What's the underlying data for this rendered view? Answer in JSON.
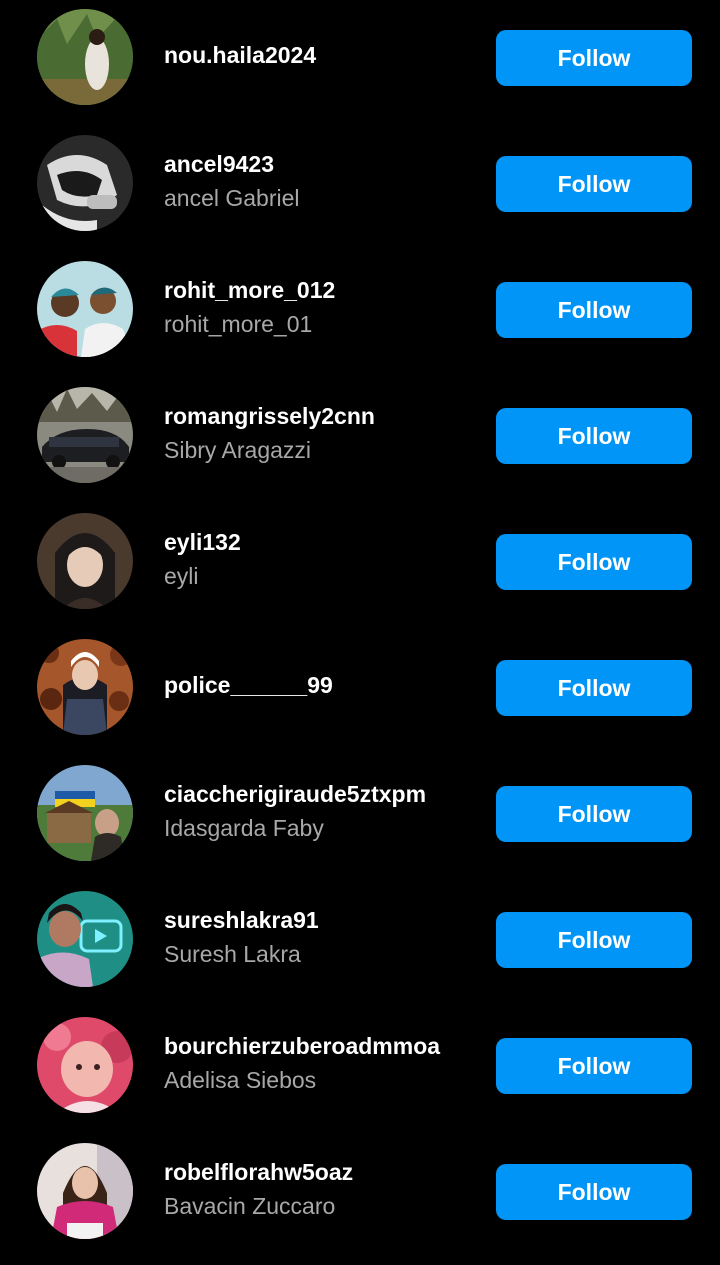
{
  "accent_color": "#0095f6",
  "suggestions": [
    {
      "username": "nou.haila2024",
      "full_name": "",
      "button": "Follow"
    },
    {
      "username": "ancel9423",
      "full_name": "ancel Gabriel",
      "button": "Follow"
    },
    {
      "username": "rohit_more_012",
      "full_name": "rohit_more_01",
      "button": "Follow"
    },
    {
      "username": "romangrissely2cnn",
      "full_name": "Sibry Aragazzi",
      "button": "Follow"
    },
    {
      "username": "eyli132",
      "full_name": "eyli",
      "button": "Follow"
    },
    {
      "username": "police______99",
      "full_name": "",
      "button": "Follow"
    },
    {
      "username": "ciaccherigiraude5ztxpm",
      "full_name": "Idasgarda Faby",
      "button": "Follow"
    },
    {
      "username": "sureshlakra91",
      "full_name": "Suresh Lakra",
      "button": "Follow"
    },
    {
      "username": "bourchierzuberoadmmoa",
      "full_name": "Adelisa Siebos",
      "button": "Follow"
    },
    {
      "username": "robelflorahw5oaz",
      "full_name": "Bavacin Zuccaro",
      "button": "Follow"
    }
  ]
}
